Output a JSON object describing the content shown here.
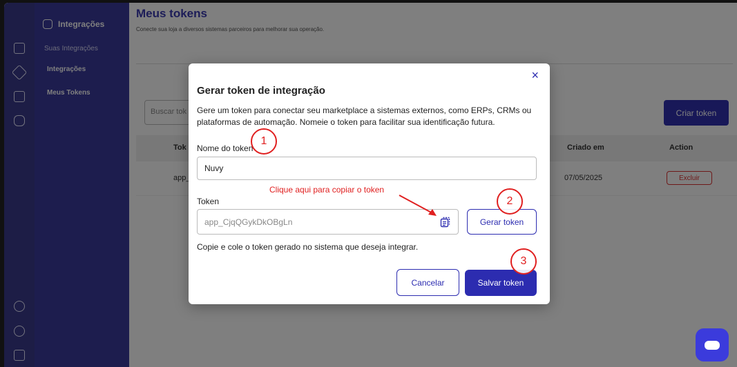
{
  "sidebar": {
    "title": "Integrações",
    "section": "Suas Integrações",
    "items": [
      {
        "label": "Integrações"
      },
      {
        "label": "Meus Tokens"
      }
    ]
  },
  "main": {
    "title": "Meus tokens",
    "subtitle": "Conecte sua loja a diversos sistemas parceiros para melhorar sua operação.",
    "search_placeholder": "Buscar tok",
    "create_button": "Criar token",
    "table": {
      "headers": [
        "Tok",
        "Criado em",
        "Action"
      ],
      "rows": [
        {
          "token": "app_",
          "created": "07/05/2025",
          "action": "Excluir"
        }
      ]
    }
  },
  "modal": {
    "title": "Gerar token de integração",
    "description": "Gere um token para conectar seu marketplace a sistemas externos, como ERPs, CRMs ou plataformas de automação. Nomeie o token para facilitar sua identificação futura.",
    "name_label": "Nome do token",
    "name_value": "Nuvy",
    "token_label": "Token",
    "token_value": "app_CjqQGykDkOBgLn",
    "generate_button": "Gerar token",
    "hint": "Copie e cole o token gerado no sistema que deseja integrar.",
    "cancel_button": "Cancelar",
    "save_button": "Salvar token",
    "close_icon": "×"
  },
  "annotations": {
    "copy_hint": "Clique aqui para copiar o token",
    "step1": "1",
    "step2": "2",
    "step3": "3"
  },
  "colors": {
    "primary": "#2c2cb0",
    "annotation": "#e02020",
    "sidebar": "#3a3a9c"
  }
}
